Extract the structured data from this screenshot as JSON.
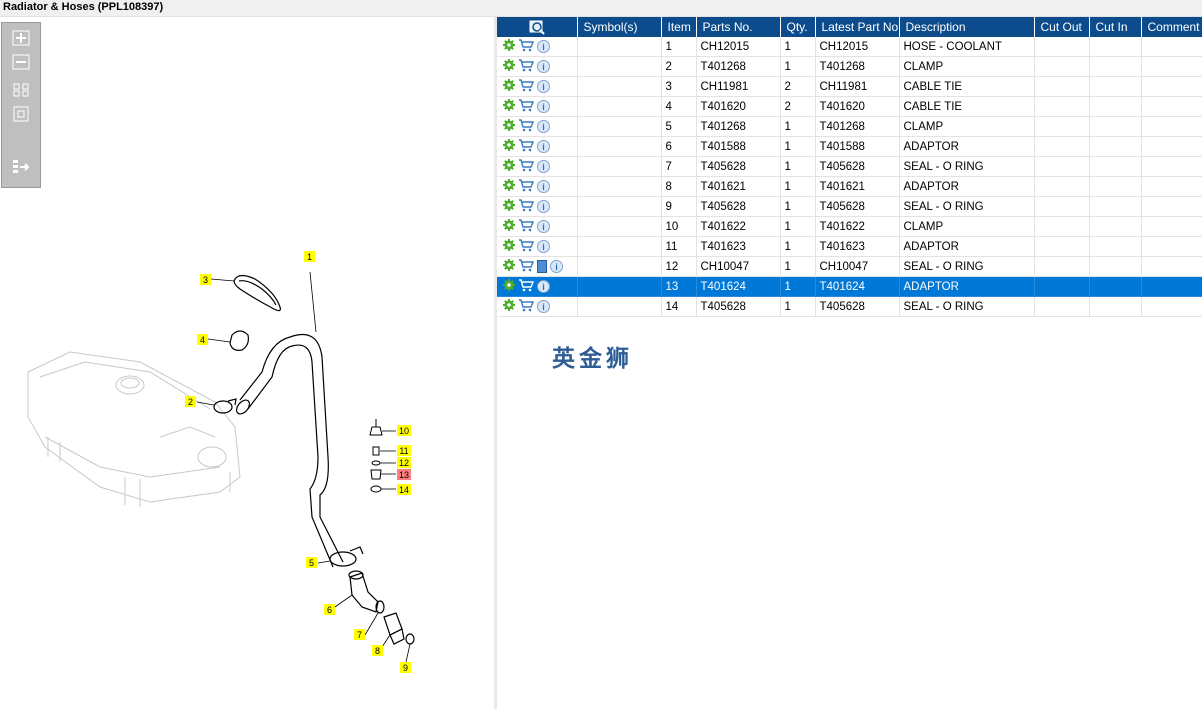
{
  "title": "Radiator & Hoses (PPL108397)",
  "toolbox": {
    "buttons": [
      "zoom-in",
      "zoom-out",
      "fit-all",
      "fit-window",
      "export"
    ]
  },
  "diagram": {
    "callouts": [
      "1",
      "2",
      "3",
      "4",
      "5",
      "6",
      "7",
      "8",
      "9",
      "10",
      "11",
      "12",
      "13",
      "14"
    ],
    "highlighted_callout": "13"
  },
  "table": {
    "columns": [
      "",
      "Symbol(s)",
      "Item",
      "Parts No.",
      "Qty.",
      "Latest Part No.",
      "Description",
      "Cut Out",
      "Cut In",
      "Comment"
    ],
    "rows": [
      {
        "item": "1",
        "parts_no": "CH12015",
        "qty": "1",
        "latest": "CH12015",
        "desc": "HOSE - COOLANT",
        "book": false,
        "selected": false
      },
      {
        "item": "2",
        "parts_no": "T401268",
        "qty": "1",
        "latest": "T401268",
        "desc": "CLAMP",
        "book": false,
        "selected": false
      },
      {
        "item": "3",
        "parts_no": "CH11981",
        "qty": "2",
        "latest": "CH11981",
        "desc": "CABLE TIE",
        "book": false,
        "selected": false
      },
      {
        "item": "4",
        "parts_no": "T401620",
        "qty": "2",
        "latest": "T401620",
        "desc": "CABLE TIE",
        "book": false,
        "selected": false
      },
      {
        "item": "5",
        "parts_no": "T401268",
        "qty": "1",
        "latest": "T401268",
        "desc": "CLAMP",
        "book": false,
        "selected": false
      },
      {
        "item": "6",
        "parts_no": "T401588",
        "qty": "1",
        "latest": "T401588",
        "desc": "ADAPTOR",
        "book": false,
        "selected": false
      },
      {
        "item": "7",
        "parts_no": "T405628",
        "qty": "1",
        "latest": "T405628",
        "desc": "SEAL - O RING",
        "book": false,
        "selected": false
      },
      {
        "item": "8",
        "parts_no": "T401621",
        "qty": "1",
        "latest": "T401621",
        "desc": "ADAPTOR",
        "book": false,
        "selected": false
      },
      {
        "item": "9",
        "parts_no": "T405628",
        "qty": "1",
        "latest": "T405628",
        "desc": "SEAL - O RING",
        "book": false,
        "selected": false
      },
      {
        "item": "10",
        "parts_no": "T401622",
        "qty": "1",
        "latest": "T401622",
        "desc": "CLAMP",
        "book": false,
        "selected": false
      },
      {
        "item": "11",
        "parts_no": "T401623",
        "qty": "1",
        "latest": "T401623",
        "desc": "ADAPTOR",
        "book": false,
        "selected": false
      },
      {
        "item": "12",
        "parts_no": "CH10047",
        "qty": "1",
        "latest": "CH10047",
        "desc": "SEAL - O RING",
        "book": true,
        "selected": false
      },
      {
        "item": "13",
        "parts_no": "T401624",
        "qty": "1",
        "latest": "T401624",
        "desc": "ADAPTOR",
        "book": false,
        "selected": true
      },
      {
        "item": "14",
        "parts_no": "T405628",
        "qty": "1",
        "latest": "T405628",
        "desc": "SEAL - O RING",
        "book": false,
        "selected": false
      }
    ]
  },
  "watermark": "英金狮",
  "colors": {
    "header_bg": "#0c4c8c",
    "selected_row": "#0078d7",
    "callout_yellow": "#ffff00",
    "callout_highlight": "#ff7f7f",
    "gear_green": "#4caf2a",
    "cart_blue": "#3a7bc8"
  }
}
